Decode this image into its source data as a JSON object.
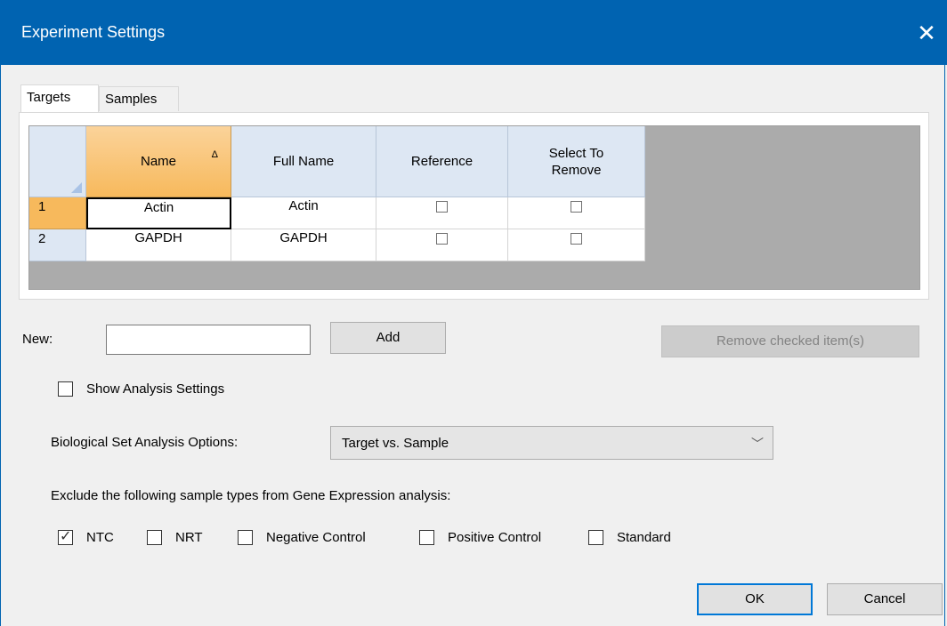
{
  "window": {
    "title": "Experiment Settings"
  },
  "tabs": [
    "Targets",
    "Samples"
  ],
  "grid": {
    "columns": [
      "Name",
      "Full Name",
      "Reference",
      "Select To\nRemove"
    ],
    "rows": [
      {
        "num": "1",
        "name": "Actin",
        "full_name": "Actin",
        "reference": false,
        "remove": false
      },
      {
        "num": "2",
        "name": "GAPDH",
        "full_name": "GAPDH",
        "reference": false,
        "remove": false
      }
    ],
    "sort_indicator": "Δ"
  },
  "new": {
    "label": "New:",
    "value": "",
    "add_label": "Add",
    "remove_label": "Remove checked item(s)"
  },
  "analysis": {
    "show_label": "Show Analysis Settings",
    "show_checked": false
  },
  "biological": {
    "label": "Biological Set Analysis Options:",
    "selected": "Target vs. Sample"
  },
  "exclude": {
    "label": "Exclude the following sample types from Gene Expression analysis:",
    "items": [
      {
        "label": "NTC",
        "checked": true
      },
      {
        "label": "NRT",
        "checked": false
      },
      {
        "label": "Negative Control",
        "checked": false
      },
      {
        "label": "Positive Control",
        "checked": false
      },
      {
        "label": "Standard",
        "checked": false
      }
    ]
  },
  "footer": {
    "ok_label": "OK",
    "cancel_label": "Cancel"
  }
}
